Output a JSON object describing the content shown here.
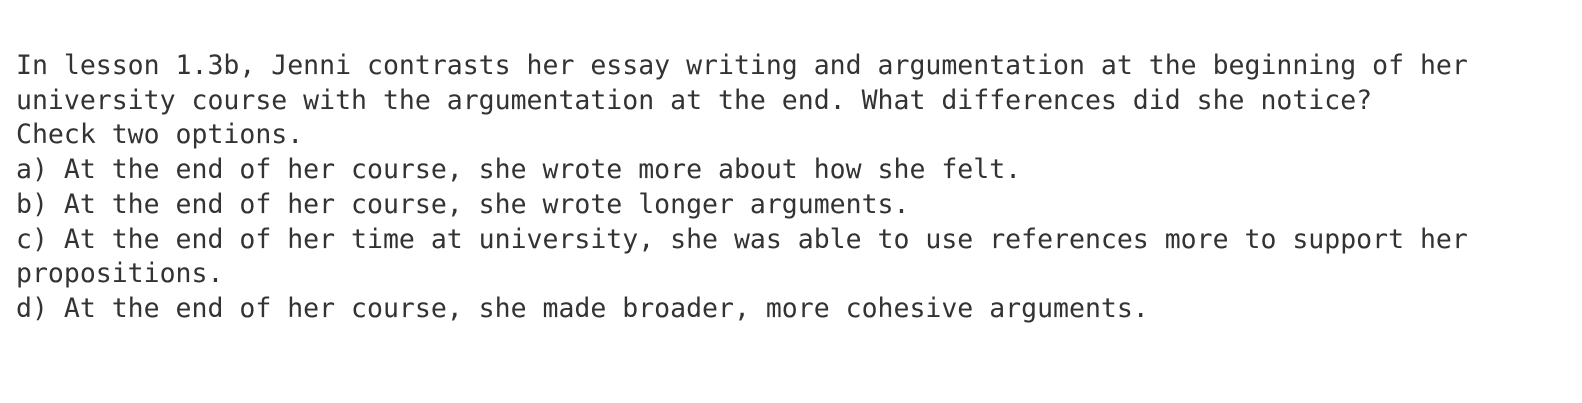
{
  "question": {
    "line1": "In lesson 1.3b, Jenni contrasts her essay writing and argumentation at the beginning of her",
    "line2": "university course with the argumentation at the end. What differences did she notice?",
    "instruction": "Check two options."
  },
  "options": {
    "a": "a) At the end of her course, she wrote more about how she felt.",
    "b": "b) At the end of her course, she wrote longer arguments.",
    "c_line1": "c) At the end of her time at university, she was able to use references more to support her",
    "c_line2": "propositions.",
    "d": "d) At the end of her course, she made broader, more cohesive arguments."
  }
}
